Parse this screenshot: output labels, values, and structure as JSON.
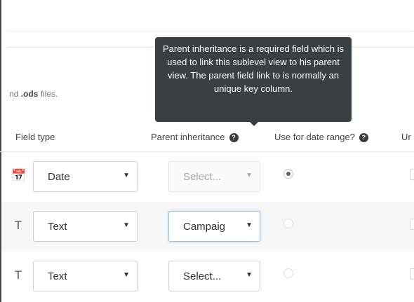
{
  "help_text": {
    "prefix": "nd ",
    "bold": ".ods",
    "suffix": " files."
  },
  "headers": {
    "field_type": "Field type",
    "parent_inheritance": "Parent inheritance",
    "use_for_date_range": "Use for date range?",
    "next_col_partial": "Ur",
    "help_glyph": "?"
  },
  "tooltip": {
    "text": "Parent inheritance is a required field which is used to link this sublevel view to his parent view. The parent field link to is normally an unique key column."
  },
  "rows": [
    {
      "type_icon": "calendar-icon",
      "type_glyph": "📅",
      "type_value": "Date",
      "parent_value": "Select...",
      "parent_state": "disabled",
      "date_range": "checked"
    },
    {
      "type_icon": "text-t-icon",
      "type_glyph": "T",
      "type_value": "Text",
      "parent_value": "Campaig",
      "parent_state": "focused",
      "date_range": "disabled"
    },
    {
      "type_icon": "text-t-icon",
      "type_glyph": "T",
      "type_value": "Text",
      "parent_value": "Select...",
      "parent_state": "normal",
      "date_range": "disabled"
    }
  ],
  "caret_glyph": "▼"
}
